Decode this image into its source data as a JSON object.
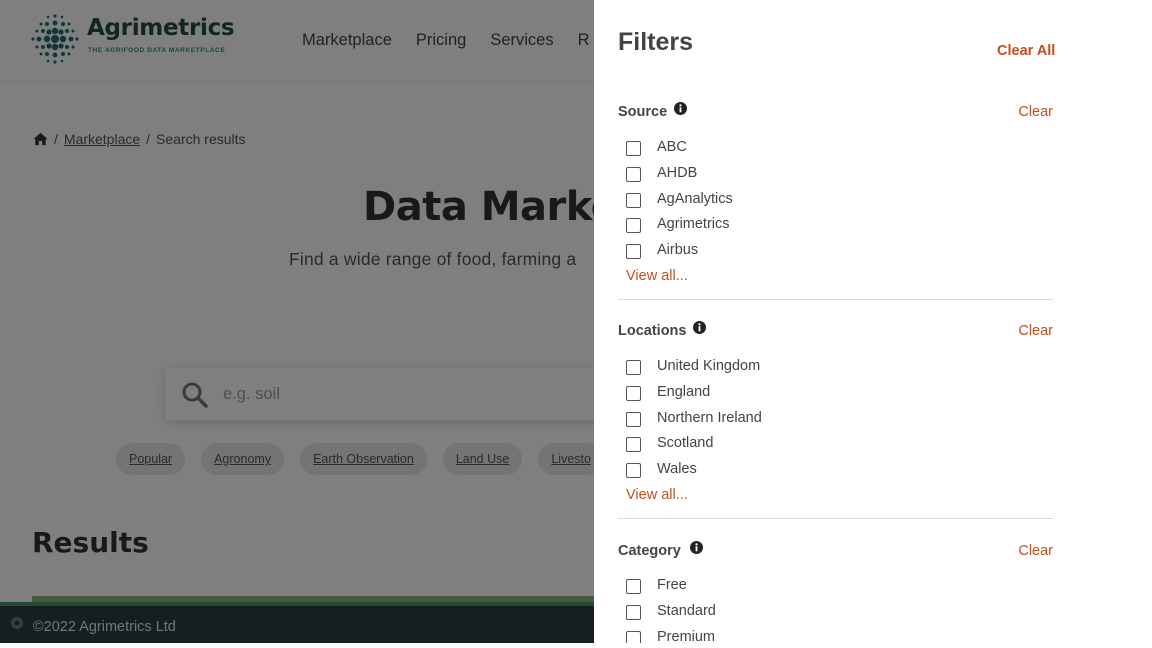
{
  "header": {
    "logo_name": "Agrimetrics",
    "logo_tagline": "THE AGRIFOOD DATA MARKETPLACE",
    "nav": [
      "Marketplace",
      "Pricing",
      "Services",
      "R"
    ]
  },
  "breadcrumb": {
    "home_icon": "home-icon",
    "items": [
      "Marketplace",
      "Search results"
    ],
    "separator": "/"
  },
  "hero": {
    "title": "Data Market",
    "subtitle": "Find a wide range of food, farming a"
  },
  "search": {
    "placeholder": "e.g. soil",
    "icon": "search-icon"
  },
  "chips": [
    "Popular",
    "Agronomy",
    "Earth Observation",
    "Land Use",
    "Livesto"
  ],
  "results": {
    "title": "Results"
  },
  "footer": {
    "copyright": "©2022 Agrimetrics Ltd"
  },
  "colors": {
    "accent": "#c0501f",
    "brand_dark": "#254b4b",
    "brand_teal": "#2e8a86",
    "footer_bg": "#2d3e3e",
    "footer_border": "#3f9a6a",
    "overlay": "rgba(0,0,0,0.5)"
  },
  "filters": {
    "title": "Filters",
    "clear_all": "Clear All",
    "sections": [
      {
        "title": "Source",
        "clear": "Clear",
        "options": [
          "ABC",
          "AHDB",
          "AgAnalytics",
          "Agrimetrics",
          "Airbus"
        ],
        "view_all": "View all..."
      },
      {
        "title": "Locations",
        "clear": "Clear",
        "options": [
          "United Kingdom",
          "England",
          "Northern Ireland",
          "Scotland",
          "Wales"
        ],
        "view_all": "View all..."
      },
      {
        "title": "Category",
        "clear": "Clear",
        "options": [
          "Free",
          "Standard",
          "Premium"
        ]
      }
    ]
  }
}
